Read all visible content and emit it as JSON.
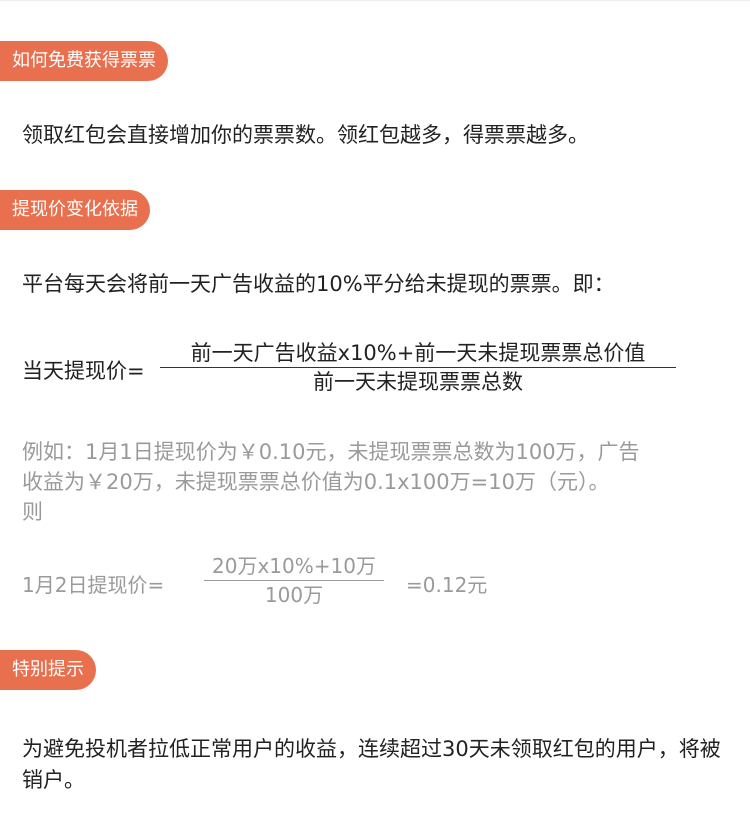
{
  "theme": {
    "tag_color": "#e8704f",
    "text_color": "#222222",
    "muted_color": "#9a9a9a"
  },
  "sections": {
    "how_to_get": {
      "tag": "如何免费获得票票",
      "text": "领取红包会直接增加你的票票数。领红包越多，得票票越多。"
    },
    "price_basis": {
      "tag": "提现价变化依据",
      "text": "平台每天会将前一天广告收益的10%平分给未提现的票票。即：",
      "formula": {
        "lhs": "当天提现价=",
        "numerator": "前一天广告收益x10%+前一天未提现票票总价值",
        "denominator": "前一天未提现票票总数"
      },
      "example": {
        "line1": "例如：1月1日提现价为￥0.10元，未提现票票总数为100万，广告",
        "line2": "收益为￥20万，未提现票票总价值为0.1x100万=10万（元）。",
        "line3": "则"
      },
      "example_formula": {
        "lhs": "1月2日提现价=",
        "numerator": "20万x10%+10万",
        "denominator": "100万",
        "rhs": "=0.12元"
      }
    },
    "notice": {
      "tag": "特别提示",
      "text": "为避免投机者拉低正常用户的收益，连续超过30天未领取红包的用户，将被销户。"
    }
  }
}
